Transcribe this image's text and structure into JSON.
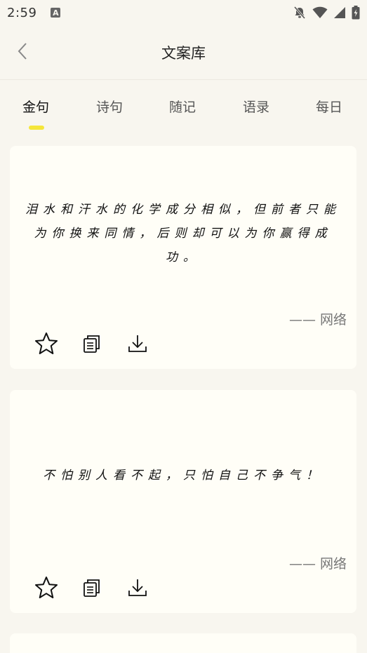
{
  "status_bar": {
    "time": "2:59",
    "app_badge": "A"
  },
  "header": {
    "title": "文案库"
  },
  "tabs": [
    {
      "label": "金句",
      "active": true
    },
    {
      "label": "诗句",
      "active": false
    },
    {
      "label": "随记",
      "active": false
    },
    {
      "label": "语录",
      "active": false
    },
    {
      "label": "每日",
      "active": false
    }
  ],
  "colors": {
    "accent": "#f5e63a",
    "background": "#f8f6ef",
    "card": "#fffef7"
  },
  "cards": [
    {
      "quote": "泪水和汗水的化学成分相似，但前者只能为你换来同情，后则却可以为你赢得成功。",
      "source": "—— 网络"
    },
    {
      "quote": "不怕别人看不起，只怕自己不争气！",
      "source": "—— 网络"
    }
  ]
}
